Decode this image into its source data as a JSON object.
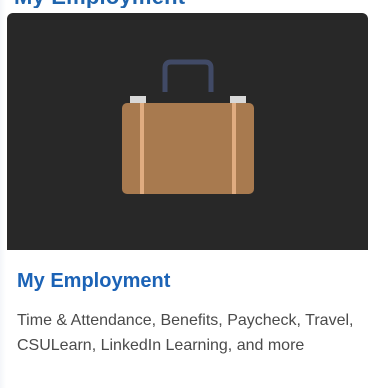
{
  "section": {
    "heading": "My Employment"
  },
  "tile": {
    "icon": "briefcase-icon",
    "title": "My Employment",
    "description": "Time & Attendance, Benefits, Paycheck, Travel, CSULearn, LinkedIn Learning, and more",
    "colors": {
      "hero_background": "#282828",
      "title": "#1c63b6",
      "description": "#4a4a4a",
      "briefcase_body": "#a87a4f",
      "briefcase_stripes": "#e0ac80",
      "briefcase_handle": "#414a66",
      "briefcase_latches": "#d8d8d8"
    }
  }
}
